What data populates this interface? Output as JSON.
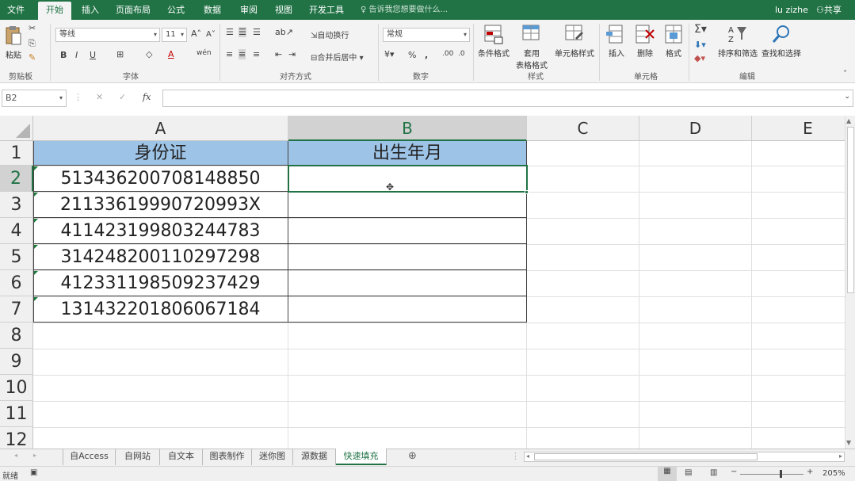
{
  "menu": {
    "tabs": [
      {
        "label": "文件"
      },
      {
        "label": "开始"
      },
      {
        "label": "插入"
      },
      {
        "label": "页面布局"
      },
      {
        "label": "公式"
      },
      {
        "label": "数据"
      },
      {
        "label": "审阅"
      },
      {
        "label": "视图"
      },
      {
        "label": "开发工具"
      }
    ],
    "tell_me": "告诉我您想要做什么...",
    "user": "lu zizhe",
    "share": "共享"
  },
  "ribbon": {
    "paste": "粘贴",
    "font_name": "等线",
    "font_size": "11",
    "wrap_text": "自动换行",
    "merge_center": "合并后居中",
    "number_format": "常规",
    "cond_format": "条件格式",
    "table_format_1": "套用",
    "table_format_2": "表格格式",
    "cell_style": "单元格样式",
    "insert": "插入",
    "delete": "删除",
    "format": "格式",
    "sort_filter": "排序和筛选",
    "find_select": "查找和选择",
    "groups": {
      "clipboard": "剪贴板",
      "font": "字体",
      "align": "对齐方式",
      "number": "数字",
      "styles": "样式",
      "cells": "单元格",
      "editing": "编辑"
    },
    "bold": "B",
    "italic": "I",
    "underline": "U",
    "percent": "%",
    "comma": ","
  },
  "formula_bar": {
    "name_box": "B2",
    "fx": "fx",
    "value": ""
  },
  "columns": [
    "A",
    "B",
    "C",
    "D",
    "E"
  ],
  "rows": [
    "1",
    "2",
    "3",
    "4",
    "5",
    "6",
    "7",
    "8",
    "9",
    "10",
    "11",
    "12"
  ],
  "sheet": {
    "header": [
      "身份证",
      "出生年月"
    ],
    "ids": [
      "513436200708148850",
      "21133619990720993X",
      "411423199803244783",
      "314248200110297298",
      "412331198509237429",
      "131432201806067184"
    ]
  },
  "sheet_tabs": [
    "自Access",
    "自网站",
    "自文本",
    "图表制作",
    "迷你图",
    "源数据",
    "快速填充"
  ],
  "status": {
    "ready": "就绪",
    "zoom": "205%"
  },
  "colors": {
    "brand": "#217346",
    "header_fill": "#9dc3e6"
  }
}
